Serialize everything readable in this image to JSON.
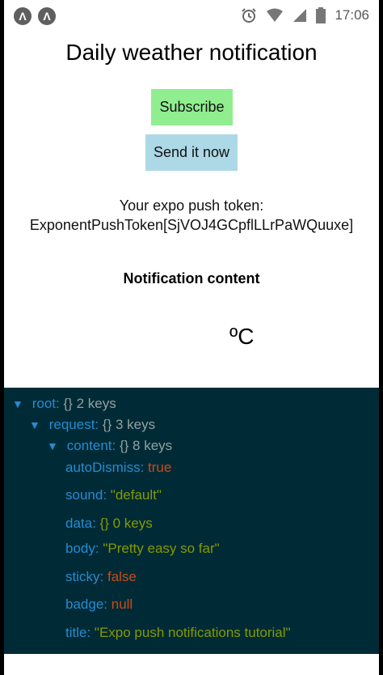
{
  "statusbar": {
    "badge_glyph": "Λ",
    "time": "17:06",
    "icons": [
      "alarm-icon",
      "wifi-icon",
      "cell-signal-icon",
      "battery-icon"
    ]
  },
  "main": {
    "title": "Daily weather notification",
    "subscribe_label": "Subscribe",
    "send_label": "Send it now",
    "token_label": "Your expo push token:",
    "token_value": "ExponentPushToken[SjVOJ4GCpflLLrPaWQuuxe]",
    "content_heading": "Notification content",
    "temperature": "ºC"
  },
  "colors": {
    "subscribe_bg": "#90ee90",
    "send_bg": "#add8e6",
    "tree_bg": "#002b36",
    "key": "#268bd2",
    "string": "#859900",
    "literal": "#cb4b16"
  },
  "tree": {
    "root": {
      "key": "root:",
      "meta": "{} 2 keys"
    },
    "request": {
      "key": "request:",
      "meta": "{} 3 keys"
    },
    "content": {
      "key": "content:",
      "meta": "{} 8 keys"
    },
    "autoDismiss": {
      "key": "autoDismiss:",
      "value": "true"
    },
    "sound": {
      "key": "sound:",
      "value": "\"default\""
    },
    "data": {
      "key": "data:",
      "value": "{} 0 keys"
    },
    "body": {
      "key": "body:",
      "value": "\"Pretty easy so far\""
    },
    "sticky": {
      "key": "sticky:",
      "value": "false"
    },
    "badge": {
      "key": "badge:",
      "value": "null"
    },
    "title": {
      "key": "title:",
      "value": "\"Expo push notifications tutorial\""
    }
  }
}
